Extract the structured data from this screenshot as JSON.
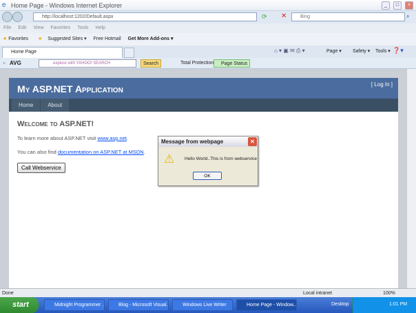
{
  "window": {
    "title": "Home Page - Windows Internet Explorer"
  },
  "address": {
    "url": "http://localhost:1202/Default.aspx",
    "search_placeholder": "Bing"
  },
  "menu": [
    "File",
    "Edit",
    "View",
    "Favorites",
    "Tools",
    "Help"
  ],
  "favorites": {
    "label": "Favorites",
    "items": [
      "Suggested Sites ▾",
      "Free Hotmail",
      "Get More Add-ons ▾"
    ]
  },
  "tab": {
    "label": "Home Page"
  },
  "command_bar": [
    "Page ▾",
    "Safety ▾",
    "Tools ▾"
  ],
  "avg_toolbar": {
    "avg": "AVG",
    "search_placeholder": "explore with YAHOO! SEARCH",
    "search": "Search",
    "total_protection": "Total Protection",
    "page_status": "Page Status"
  },
  "site": {
    "title": "My ASP.NET Application",
    "login": "[ Log In ]",
    "nav": [
      "Home",
      "About"
    ],
    "heading": "Welcome to ASP.NET!",
    "p1": "To learn more about ASP.NET visit ",
    "p1_link": "www.asp.net",
    "p2": "You can also find ",
    "p2_link": "documentation on ASP.NET at MSDN",
    "button": "Call Webservice"
  },
  "dialog": {
    "title": "Message from webpage",
    "message": "Hello World..This is from webservice",
    "ok": "OK"
  },
  "status": {
    "text": "Done",
    "zone": "Local intranet",
    "zoom": "100%"
  },
  "taskbar": {
    "start": "start",
    "items": [
      "Midnight Programmer ...",
      "Blog - Microsoft Visual...",
      "Windows Live Writer",
      "Home Page - Window..."
    ],
    "desktop": "Desktop",
    "clock": "1:01 PM"
  }
}
